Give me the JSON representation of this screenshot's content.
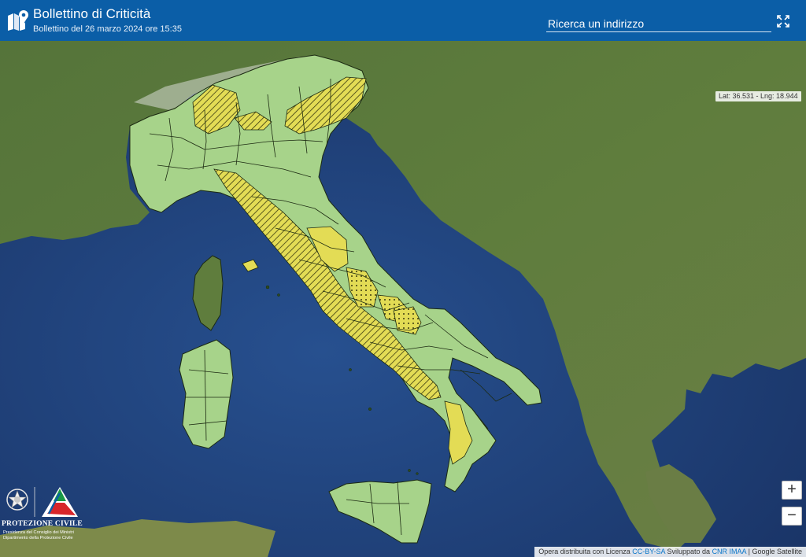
{
  "header": {
    "title": "Bollettino di Criticità",
    "subtitle": "Bollettino del 26 marzo 2024 ore 15:35",
    "search_placeholder": "Ricerca un indirizzo",
    "icon": "map-pin-icon",
    "fullscreen_icon": "fullscreen-icon",
    "background": "#0b5ea7"
  },
  "map": {
    "coordinates": "Lat: 36.531 - Lng: 18.944",
    "zoom_in": "+",
    "zoom_out": "−",
    "colors": {
      "green_zone": "#a8d68a",
      "yellow_zone": "#e6e05a",
      "sea": "#1f3f7a",
      "land": "#4c6a32"
    },
    "legend_states": [
      "green",
      "yellow-hatched",
      "yellow-dotted",
      "yellow"
    ]
  },
  "attribution": {
    "prefix": "Opera distribuita con Licenza",
    "license": "CC-BY-SA",
    "developed": "Sviluppato da",
    "org": "CNR IMAA",
    "separator": "|",
    "layer": "Google Satellite"
  },
  "logo": {
    "name": "PROTEZIONE CIVILE",
    "line1": "Presidenza del Consiglio dei Ministri",
    "line2": "Dipartimento della Protezione Civile"
  }
}
